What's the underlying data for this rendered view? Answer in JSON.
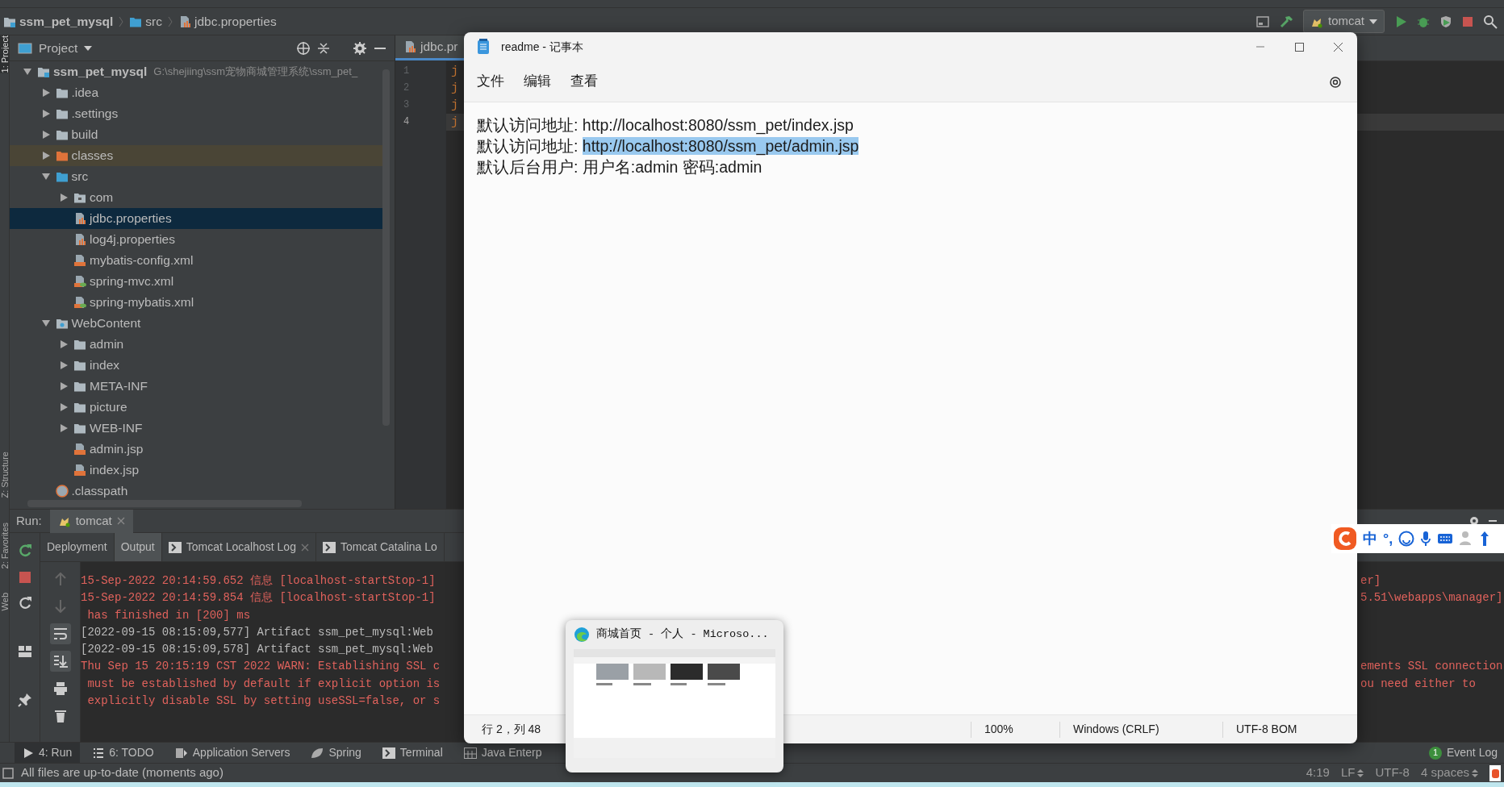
{
  "breadcrumb": [
    {
      "label": "ssm_pet_mysql",
      "kind": "module"
    },
    {
      "label": "src",
      "kind": "source-folder"
    },
    {
      "label": "jdbc.properties",
      "kind": "properties"
    }
  ],
  "toolbar": {
    "run_config": "tomcat"
  },
  "side_stripe": [
    {
      "label": "1: Project",
      "selected": true
    },
    {
      "label": "Z: Structure",
      "selected": false
    },
    {
      "label": "2: Favorites",
      "selected": false
    },
    {
      "label": "Web",
      "selected": false
    }
  ],
  "project_panel": {
    "title": "Project",
    "tree": [
      {
        "label": "ssm_pet_mysql",
        "path": "G:\\shejiing\\ssm宠物商城管理系统\\ssm_pet_",
        "kind": "module",
        "expanded": true,
        "selected": false,
        "children": [
          {
            "label": ".idea",
            "kind": "folder",
            "expanded": false,
            "selected": false
          },
          {
            "label": ".settings",
            "kind": "folder",
            "expanded": false,
            "selected": false
          },
          {
            "label": "build",
            "kind": "folder",
            "expanded": false,
            "selected": false
          },
          {
            "label": "classes",
            "kind": "excluded-folder",
            "expanded": false,
            "selected": false
          },
          {
            "label": "src",
            "kind": "source-folder",
            "expanded": true,
            "selected": false,
            "children": [
              {
                "label": "com",
                "kind": "package",
                "expanded": false,
                "selected": false
              },
              {
                "label": "jdbc.properties",
                "kind": "properties",
                "selected": true
              },
              {
                "label": "log4j.properties",
                "kind": "properties",
                "selected": false
              },
              {
                "label": "mybatis-config.xml",
                "kind": "xml",
                "selected": false
              },
              {
                "label": "spring-mvc.xml",
                "kind": "spring-xml",
                "selected": false
              },
              {
                "label": "spring-mybatis.xml",
                "kind": "spring-xml",
                "selected": false
              }
            ]
          },
          {
            "label": "WebContent",
            "kind": "web-folder",
            "expanded": true,
            "selected": false,
            "children": [
              {
                "label": "admin",
                "kind": "folder",
                "expanded": false,
                "selected": false
              },
              {
                "label": "index",
                "kind": "folder",
                "expanded": false,
                "selected": false
              },
              {
                "label": "META-INF",
                "kind": "folder",
                "expanded": false,
                "selected": false
              },
              {
                "label": "picture",
                "kind": "folder",
                "expanded": false,
                "selected": false
              },
              {
                "label": "WEB-INF",
                "kind": "folder",
                "expanded": false,
                "selected": false
              },
              {
                "label": "admin.jsp",
                "kind": "jsp",
                "selected": false
              },
              {
                "label": "index.jsp",
                "kind": "jsp",
                "selected": false
              }
            ]
          },
          {
            "label": ".classpath",
            "kind": "classpath",
            "selected": false
          }
        ]
      }
    ]
  },
  "editor": {
    "tabs": [
      {
        "label": "jdbc.pr",
        "selected": true
      }
    ],
    "lines": [
      {
        "number": "1",
        "text": "j",
        "current": false
      },
      {
        "number": "2",
        "text": "j",
        "current": false
      },
      {
        "number": "3",
        "text": "j",
        "current": false
      },
      {
        "number": "4",
        "text": "j",
        "current": true
      }
    ]
  },
  "run_panel": {
    "label": "Run:",
    "tabs": [
      {
        "label": "tomcat",
        "selected": true,
        "closable": true
      }
    ],
    "subtabs": [
      {
        "label": "Deployment",
        "selected": false,
        "kind": "plain",
        "closable": false
      },
      {
        "label": "Output",
        "selected": true,
        "kind": "plain",
        "closable": false
      },
      {
        "label": "Tomcat Localhost Log",
        "selected": false,
        "kind": "log",
        "closable": true
      },
      {
        "label": "Tomcat Catalina Lo",
        "selected": false,
        "kind": "log",
        "closable": false
      }
    ],
    "toggles": {
      "soft_wrap": true,
      "scroll_to_end": true
    },
    "console": [
      {
        "text": "15-Sep-2022 20:14:59.652 信息 [localhost-startStop-1]",
        "tail": "er]",
        "kind": "error"
      },
      {
        "text": "15-Sep-2022 20:14:59.854 信息 [localhost-startStop-1]",
        "tail": "5.51\\webapps\\manager]",
        "kind": "error"
      },
      {
        "text": " has finished in [200] ms",
        "kind": "error"
      },
      {
        "text": "[2022-09-15 08:15:09,577] Artifact ssm_pet_mysql:Web",
        "kind": "info"
      },
      {
        "text": "[2022-09-15 08:15:09,578] Artifact ssm_pet_mysql:Web",
        "kind": "info"
      },
      {
        "text": "Thu Sep 15 20:15:19 CST 2022 WARN: Establishing SSL c",
        "tail": "ements SSL connection",
        "kind": "error"
      },
      {
        "text": " must be established by default if explicit option is",
        "tail": "ou need either to",
        "kind": "error"
      },
      {
        "text": " explicitly disable SSL by setting useSSL=false, or s",
        "kind": "error"
      }
    ]
  },
  "tool_tabs": [
    {
      "label": "4: Run",
      "kind": "run",
      "selected": true
    },
    {
      "label": "6: TODO",
      "kind": "todo",
      "selected": false
    },
    {
      "label": "Application Servers",
      "kind": "servers",
      "selected": false
    },
    {
      "label": "Spring",
      "kind": "spring",
      "selected": false
    },
    {
      "label": "Terminal",
      "kind": "terminal",
      "selected": false
    },
    {
      "label": "Java Enterp",
      "kind": "javaee",
      "selected": false
    }
  ],
  "event_log": {
    "label": "Event Log",
    "count": "1"
  },
  "status_bar": {
    "message": "All files are up-to-date (moments ago)",
    "items": [
      {
        "label": "4:19",
        "chooser": false
      },
      {
        "label": "LF",
        "chooser": true
      },
      {
        "label": "UTF-8",
        "chooser": false
      },
      {
        "label": "4 spaces",
        "chooser": true
      }
    ]
  },
  "ime_bar": {
    "mode": "中",
    "punctuation": "°,"
  },
  "notepad": {
    "title": "readme - 记事本",
    "menu": [
      "文件",
      "编辑",
      "查看"
    ],
    "lines": [
      {
        "text": "默认访问地址: ",
        "link": "http://localhost:8080/ssm_pet/index.jsp",
        "selected": false
      },
      {
        "text": "默认访问地址: ",
        "link": "http://localhost:8080/ssm_pet/admin.jsp",
        "selected": true
      },
      {
        "text": "默认后台用户: 用户名:admin 密码:admin"
      }
    ],
    "status": {
      "position": "行 2，列 48",
      "zoom": "100%",
      "line_ending": "Windows (CRLF)",
      "encoding": "UTF-8 BOM"
    }
  },
  "taskbar_preview": {
    "title": "商城首页 - 个人 - Microso...",
    "kind": "picture"
  }
}
